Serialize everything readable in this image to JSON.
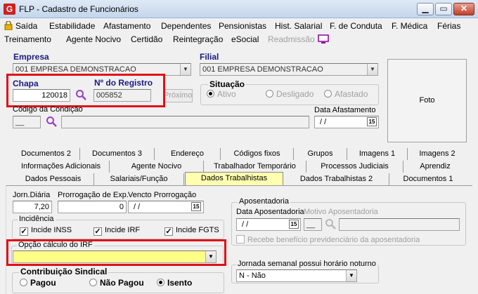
{
  "window": {
    "title": "FLP - Cadastro de Funcionários",
    "icon": "app-g-icon"
  },
  "menu": {
    "row1": [
      "Saída",
      "Estabilidade",
      "Afastamento",
      "Dependentes",
      "Pensionistas",
      "Hist. Salarial",
      "F. de Conduta",
      "F. Médica",
      "Férias"
    ],
    "row2": [
      "Treinamento",
      "Agente Nocivo",
      "Certidão",
      "Reintegração",
      "eSocial",
      "Readmissão"
    ]
  },
  "empresa": {
    "label": "Empresa",
    "value": "001 EMPRESA DEMONSTRACAO"
  },
  "filial": {
    "label": "Filial",
    "value": "001 EMPRESA DEMONSTRACAO"
  },
  "chapa": {
    "label": "Chapa",
    "value": "120018"
  },
  "registro": {
    "label": "Nº do Registro",
    "value": "005852",
    "proximo": "Próximo"
  },
  "situacao": {
    "label": "Situação",
    "options": [
      "Ativo",
      "Desligado",
      "Afastado"
    ]
  },
  "photo": {
    "label": "Foto"
  },
  "condicao": {
    "label": "Código da Condição",
    "value": "__"
  },
  "afastamento": {
    "label": "Data Afastamento",
    "value": "/ /",
    "cal": "15"
  },
  "tabs": {
    "row1": [
      "Documentos 2",
      "Documentos 3",
      "Endereço",
      "Códigos fixos",
      "Grupos",
      "Imagens 1",
      "Imagens 2"
    ],
    "row2": [
      "Informações Adicionais",
      "Agente Nocivo",
      "Trabalhador Temporário",
      "Processos Judiciais",
      "Aprendiz"
    ],
    "row3": [
      "Dados Pessoais",
      "Salariais/Função",
      "Dados Trabalhistas",
      "Dados Trabalhistas 2",
      "Documentos 1"
    ]
  },
  "jornada": {
    "label": "Jorn.Diária",
    "value": "7,20"
  },
  "prorrogacao": {
    "label": "Prorrogação de Exp.",
    "value": "0"
  },
  "vencto": {
    "label": "Vencto Prorrogação",
    "value": "/ /",
    "cal": "15"
  },
  "incidencia": {
    "label": "Incidência",
    "items": [
      "Incide INSS",
      "Incide IRF",
      "Incide FGTS"
    ],
    "mark": "✓"
  },
  "irf": {
    "label": "Opção cálculo do IRF",
    "value": ""
  },
  "sindical": {
    "label": "Contribuição Sindical",
    "options": [
      "Pagou",
      "Não Pagou",
      "Isento"
    ]
  },
  "aposentadoria": {
    "label": "Aposentadoria",
    "data_label": "Data Aposentadoria",
    "data_value": "/ /",
    "cal": "15",
    "motivo_label": "Motivo Aposentadoria",
    "motivo_code": "__",
    "beneficio": "Recebe benefício previdenciário da aposentadoria"
  },
  "noturno": {
    "label": "Jornada semanal possui horário noturno",
    "value": "N - Não"
  },
  "colors": {
    "highlight": "#ffff88",
    "redbox": "#e0101a",
    "tab_active": "#ffffb0",
    "label_blue": "#1a1a80"
  }
}
